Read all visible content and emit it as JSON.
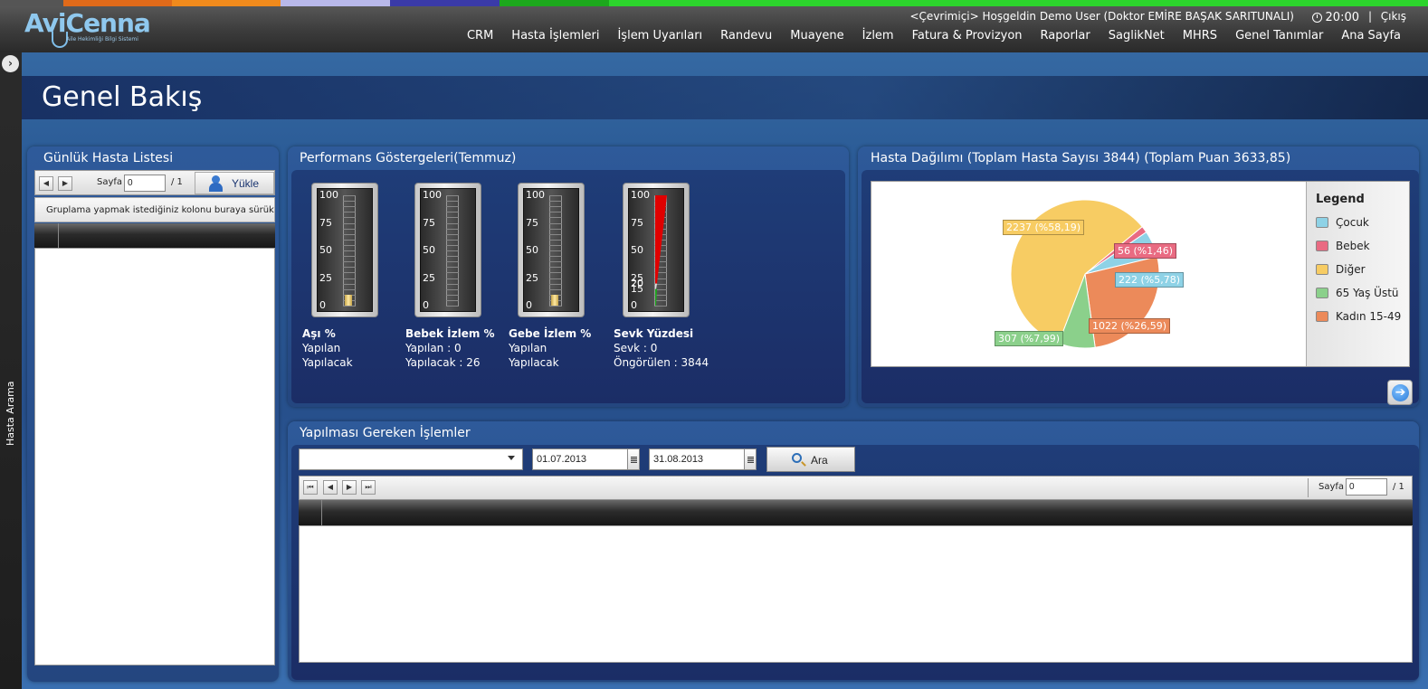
{
  "app": {
    "logo_text": "AviCenna",
    "logo_subtitle": "Aile Hekimliği Bilgi Sistemi",
    "welcome_text": "<Çevrimiçi> Hoşgeldin Demo User (Doktor EMİRE BAŞAK SARITUNALI)",
    "clock": "20:00",
    "separator": "|",
    "logout": "Çıkış"
  },
  "nav": {
    "items": [
      "CRM",
      "Hasta İşlemleri",
      "İşlem Uyarıları",
      "Randevu",
      "Muayene",
      "İzlem",
      "Fatura & Provizyon",
      "Raporlar",
      "SaglikNet",
      "MHRS",
      "Genel Tanımlar",
      "Ana Sayfa"
    ]
  },
  "sidebar": {
    "label": "Hasta Arama",
    "expander": "›"
  },
  "page": {
    "title": "Genel Bakış"
  },
  "patient_list": {
    "title": "Günlük Hasta Listesi",
    "page_label": "Sayfa",
    "page_value": "0",
    "page_total": "/ 1",
    "load_button": "Yükle",
    "group_hint": "Gruplama yapmak istediğiniz kolonu buraya sürükleyin"
  },
  "performance": {
    "title": "Performans Göstergeleri(Temmuz)",
    "gauges": [
      {
        "title": "Aşı %",
        "line1": "Yapılan",
        "line2": "Yapılacak",
        "value": 4
      },
      {
        "title": "Bebek İzlem %",
        "line1": "Yapılan : 0",
        "line2": "Yapılacak : 26",
        "value": 0
      },
      {
        "title": "Gebe İzlem %",
        "line1": "Yapılan",
        "line2": "Yapılacak",
        "value": 4
      },
      {
        "title": "Sevk Yüzdesi",
        "line1": "Sevk : 0",
        "line2": "Öngörülen : 3844",
        "value": 0
      }
    ],
    "scale_labels": [
      "100",
      "75",
      "50",
      "25",
      "0"
    ],
    "sevk_extra_labels": [
      "20",
      "15"
    ]
  },
  "distribution": {
    "title": "Hasta Dağılımı (Toplam Hasta Sayısı 3844) (Toplam Puan 3633,85)",
    "legend_title": "Legend"
  },
  "chart_data": {
    "type": "pie",
    "categories": [
      "Çocuk",
      "Bebek",
      "Diğer",
      "65 Yaş Üstü",
      "Kadın 15-49"
    ],
    "values": [
      222,
      56,
      2237,
      307,
      1022
    ],
    "labels": [
      "222 (%5,78)",
      "56 (%1,46)",
      "2237 (%58,19)",
      "307 (%7,99)",
      "1022 (%26,59)"
    ],
    "colors": [
      "#8ed2e6",
      "#e96b82",
      "#f7cc63",
      "#8bd08b",
      "#ec8a5a"
    ],
    "legend_position": "right"
  },
  "tasks": {
    "title": "Yapılması Gereken İşlemler",
    "select_value": "",
    "start_date": "01.07.2013",
    "end_date": "31.08.2013",
    "search_button": "Ara",
    "page_label": "Sayfa",
    "page_value": "0",
    "page_total": "/ 1"
  },
  "colors": {
    "strip": [
      "#555555",
      "#e06a1a",
      "#f08a1c",
      "#b8b8ea",
      "#3a3aa8",
      "#1ca81c",
      "#2cd42c"
    ]
  }
}
